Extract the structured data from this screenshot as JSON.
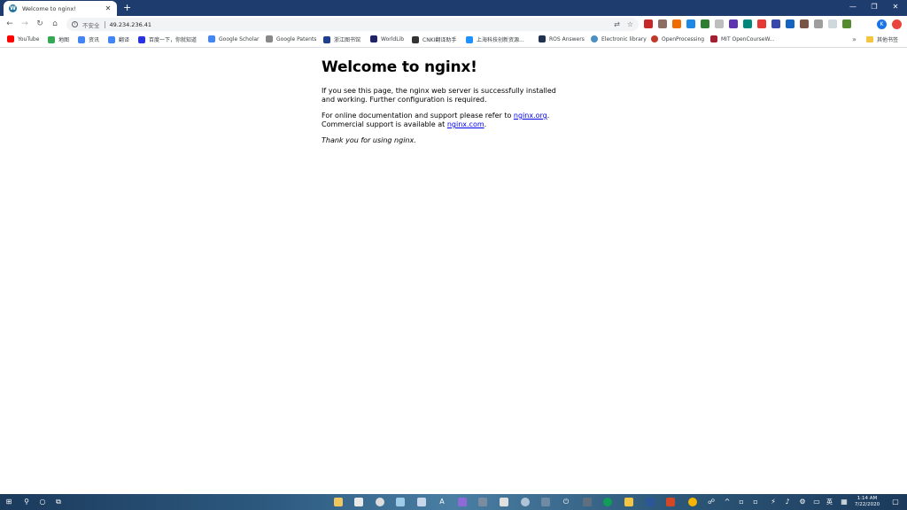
{
  "browser": {
    "tab": {
      "title": "Welcome to nginx!"
    },
    "new_tab_label": "+",
    "window_controls": {
      "minimize": "—",
      "restore": "❐",
      "close": "✕"
    },
    "nav": {
      "back": "←",
      "forward": "→",
      "reload": "↻",
      "home": "⌂"
    },
    "address": {
      "security_label": "不安全",
      "url": "49.234.236.41"
    },
    "profile_initial": "K",
    "colors": {
      "titlebar": "#1e3d6e",
      "link": "#0000ee"
    }
  },
  "bookmarks": {
    "items": [
      {
        "label": "YouTube",
        "color": "#ff0000"
      },
      {
        "label": "地图",
        "color": "#34a853"
      },
      {
        "label": "资讯",
        "color": "#4285f4"
      },
      {
        "label": "翻译",
        "color": "#4285f4"
      },
      {
        "label": "百度一下，你就知道",
        "color": "#2932e1"
      },
      {
        "label": "Google Scholar",
        "color": "#4285f4"
      },
      {
        "label": "Google Patents",
        "color": "#888888"
      },
      {
        "label": "浙江图书馆",
        "color": "#1c3f94"
      },
      {
        "label": "WorldLib",
        "color": "#222266"
      },
      {
        "label": "CNKI翻译助手",
        "color": "#333333"
      },
      {
        "label": "上海科技创新资源...",
        "color": "#1e90ff"
      },
      {
        "label": "ROS Answers",
        "color": "#22314e"
      },
      {
        "label": "Electronic library",
        "color": "#4a90c2"
      },
      {
        "label": "OpenProcessing",
        "color": "#c0392b"
      },
      {
        "label": "MIT OpenCourseW...",
        "color": "#a31f34"
      }
    ],
    "more": "»",
    "other": "其他书签"
  },
  "page": {
    "heading": "Welcome to nginx!",
    "para1": "If you see this page, the nginx web server is successfully installed and working. Further configuration is required.",
    "para2_prefix": "For online documentation and support please refer to ",
    "link1": "nginx.org",
    "para2_middle": ".",
    "para2_line2": "Commercial support is available at ",
    "link2": "nginx.com",
    "para2_suffix": ".",
    "thanks": "Thank you for using nginx."
  },
  "taskbar": {
    "lang": "英",
    "time": "1:14 AM",
    "date": "7/22/2020"
  }
}
